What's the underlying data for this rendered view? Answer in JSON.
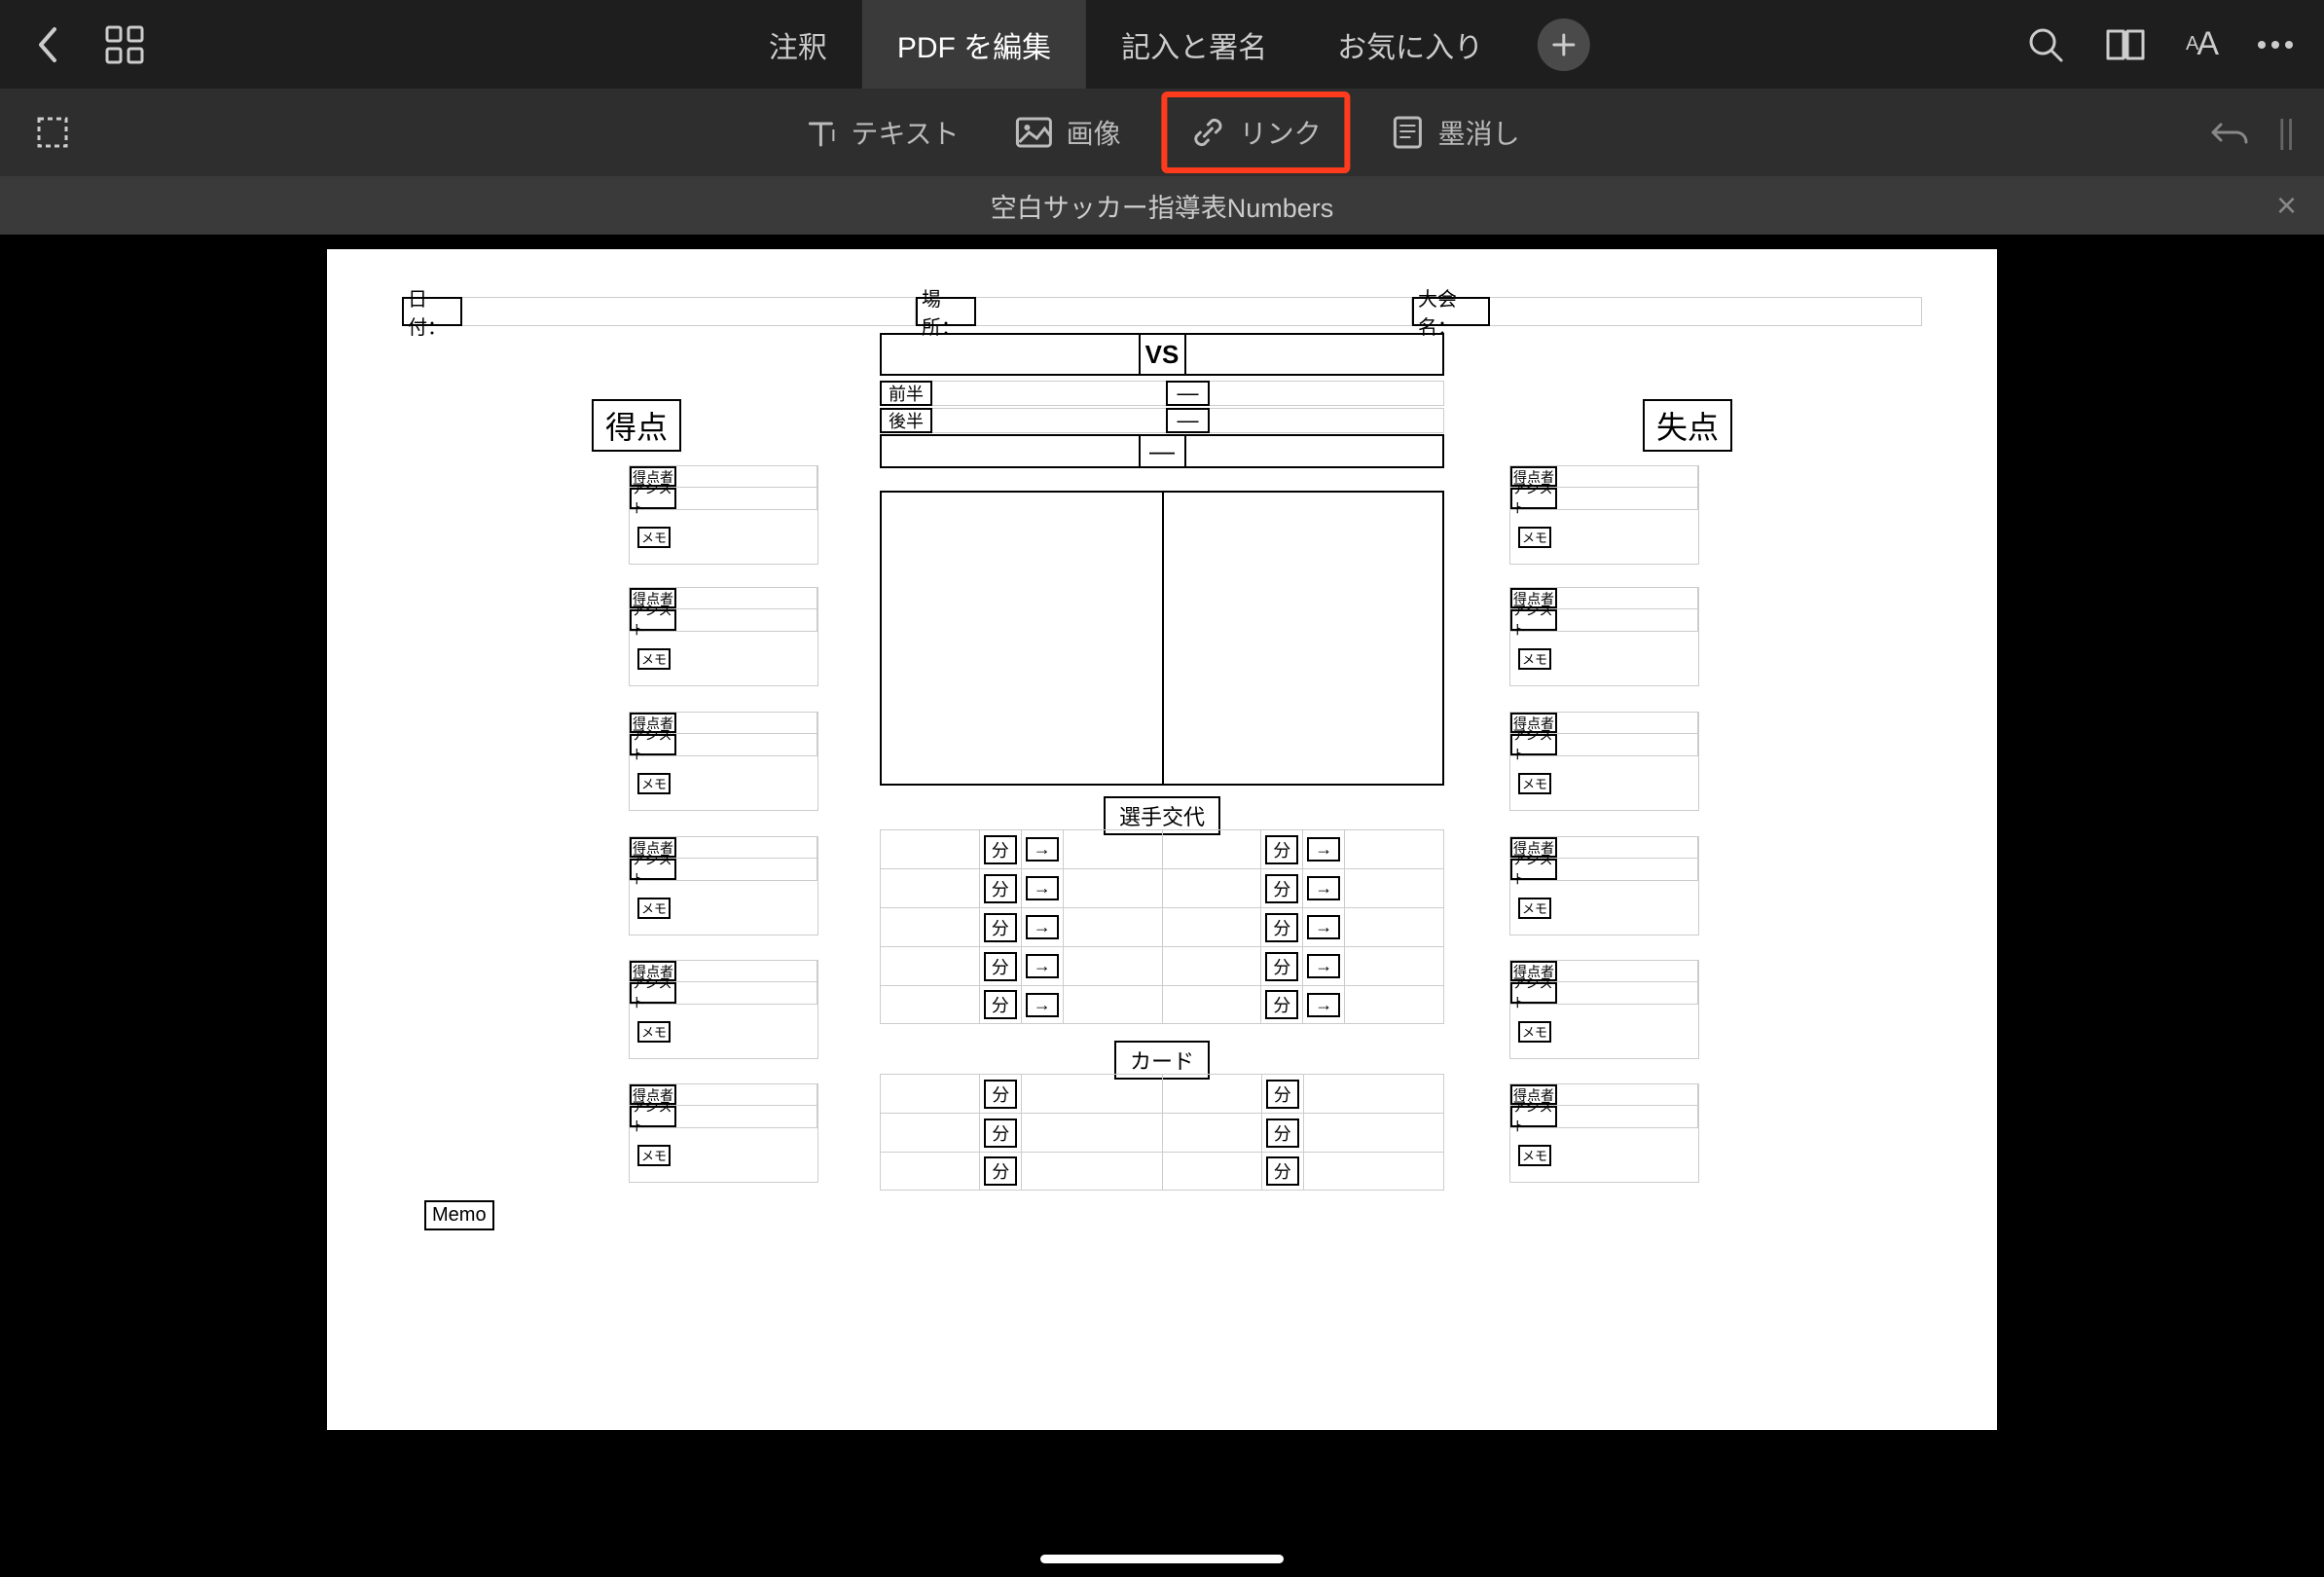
{
  "header": {
    "tabs": [
      "注釈",
      "PDF を編集",
      "記入と署名",
      "お気に入り"
    ],
    "active_tab_index": 1
  },
  "toolbar": {
    "text": "テキスト",
    "image": "画像",
    "link": "リンク",
    "redact": "墨消し"
  },
  "doc_title": "空白サッカー指導表Numbers",
  "form": {
    "date_label": "日付：",
    "place_label": "場所：",
    "tournament_label": "大会名：",
    "vs": "VS",
    "first_half": "前半",
    "second_half": "後半",
    "dash": "―",
    "goals_for": "得点",
    "goals_against": "失点",
    "scorer": "得点者",
    "assist": "アシスト",
    "memo_small": "メモ",
    "substitution": "選手交代",
    "minute": "分",
    "arrow": "→",
    "card": "カード",
    "memo": "Memo"
  }
}
